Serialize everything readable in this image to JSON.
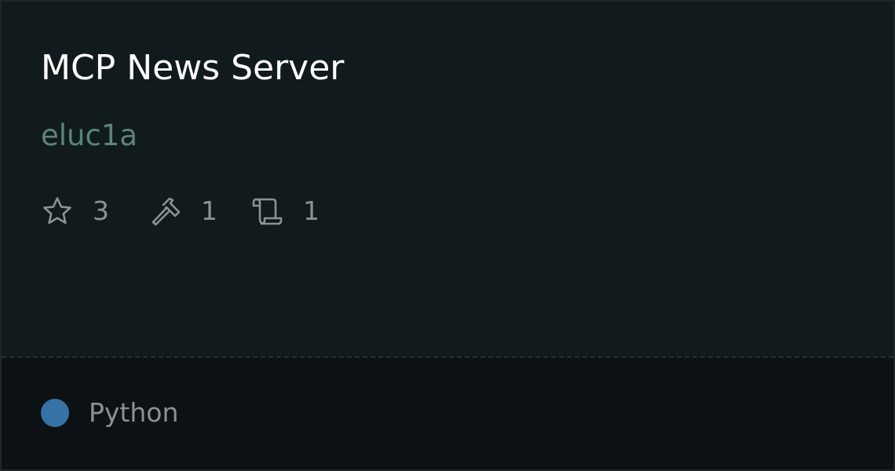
{
  "card": {
    "title": "MCP News Server",
    "author": "eluc1a",
    "stats": {
      "stars": {
        "icon": "star-icon",
        "count": "3"
      },
      "tools": {
        "icon": "hammer-icon",
        "count": "1"
      },
      "docs": {
        "icon": "scroll-icon",
        "count": "1"
      }
    },
    "language": {
      "name": "Python",
      "color": "#3572a5"
    }
  },
  "colors": {
    "title": "#ffffff",
    "author": "#5b8479",
    "muted": "#8b9296",
    "card_bg": "#111a1d",
    "footer_bg": "#0c1114"
  }
}
